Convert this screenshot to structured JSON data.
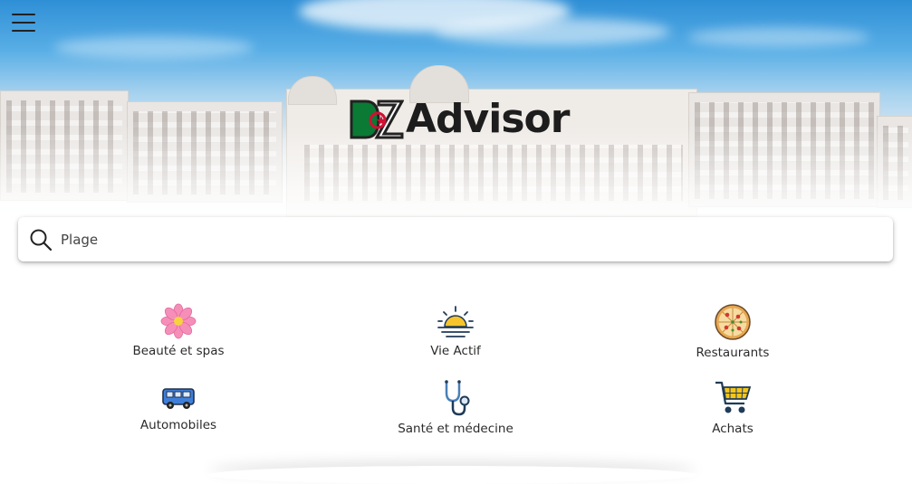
{
  "header": {
    "menu_icon": "hamburger-icon",
    "logo_text": "Advisor",
    "logo_mark": "DZ"
  },
  "search": {
    "value": "Plage",
    "placeholder": "",
    "icon": "search-icon"
  },
  "categories": [
    {
      "label": "Beauté et spas",
      "icon": "flower-icon"
    },
    {
      "label": "Vie Actif",
      "icon": "sunrise-icon"
    },
    {
      "label": "Restaurants",
      "icon": "pizza-icon"
    },
    {
      "label": "Automobiles",
      "icon": "car-icon"
    },
    {
      "label": "Santé et médecine",
      "icon": "stethoscope-icon"
    },
    {
      "label": "Achats",
      "icon": "shopping-cart-icon"
    }
  ],
  "colors": {
    "algeria_green": "#0a7a35",
    "algeria_red": "#d21034",
    "cart_yellow": "#f5c518"
  }
}
